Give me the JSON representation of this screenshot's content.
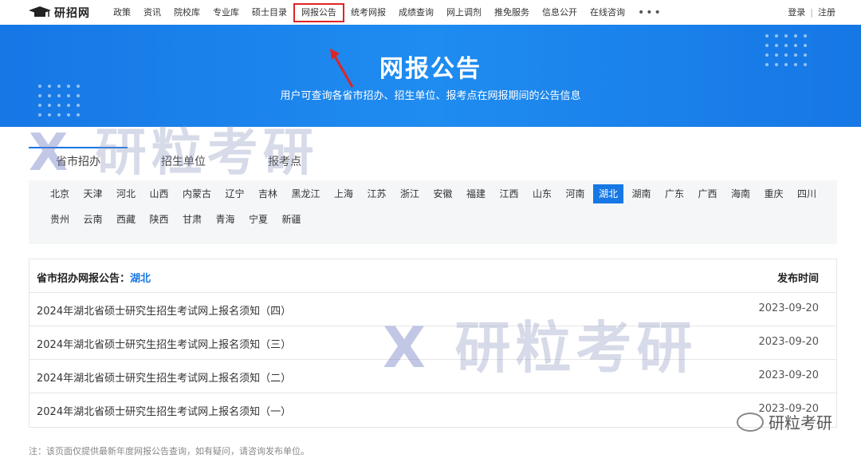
{
  "header": {
    "logo_text": "研招网",
    "nav": [
      "政策",
      "资讯",
      "院校库",
      "专业库",
      "硕士目录",
      "网报公告",
      "统考网报",
      "成绩查询",
      "网上调剂",
      "推免服务",
      "信息公开",
      "在线咨询"
    ],
    "nav_highlight_index": 5,
    "more": "•••",
    "login": "登录",
    "separator": "|",
    "register": "注册"
  },
  "hero": {
    "title": "网报公告",
    "subtitle": "用户可查询各省市招办、招生单位、报考点在网报期间的公告信息",
    "bg_color": "#1a80ea"
  },
  "tabs": [
    "省市招办",
    "招生单位",
    "报考点"
  ],
  "active_tab": 0,
  "provinces": {
    "row1": [
      "北京",
      "天津",
      "河北",
      "山西",
      "内蒙古",
      "辽宁",
      "吉林",
      "黑龙江",
      "上海",
      "江苏",
      "浙江",
      "安徽",
      "福建",
      "江西",
      "山东",
      "河南",
      "湖北",
      "湖南",
      "广东",
      "广西",
      "海南",
      "重庆",
      "四川"
    ],
    "row2": [
      "贵州",
      "云南",
      "西藏",
      "陕西",
      "甘肃",
      "青海",
      "宁夏",
      "新疆"
    ],
    "active": "湖北"
  },
  "table": {
    "header_label": "省市招办网报公告：",
    "header_province": "湖北",
    "time_header": "发布时间",
    "rows": [
      {
        "title": "2024年湖北省硕士研究生招生考试网上报名须知（四）",
        "date": "2023-09-20"
      },
      {
        "title": "2024年湖北省硕士研究生招生考试网上报名须知（三）",
        "date": "2023-09-20"
      },
      {
        "title": "2024年湖北省硕士研究生招生考试网上报名须知（二）",
        "date": "2023-09-20"
      },
      {
        "title": "2024年湖北省硕士研究生招生考试网上报名须知（一）",
        "date": "2023-09-20"
      }
    ]
  },
  "note": "注：该页面仅提供最新年度网报公告查询，如有疑问，请咨询发布单位。",
  "watermark": {
    "text": "研粒考研",
    "badge": "研粒考研"
  },
  "colors": {
    "accent": "#1677e5",
    "highlight_border": "#e02424"
  }
}
